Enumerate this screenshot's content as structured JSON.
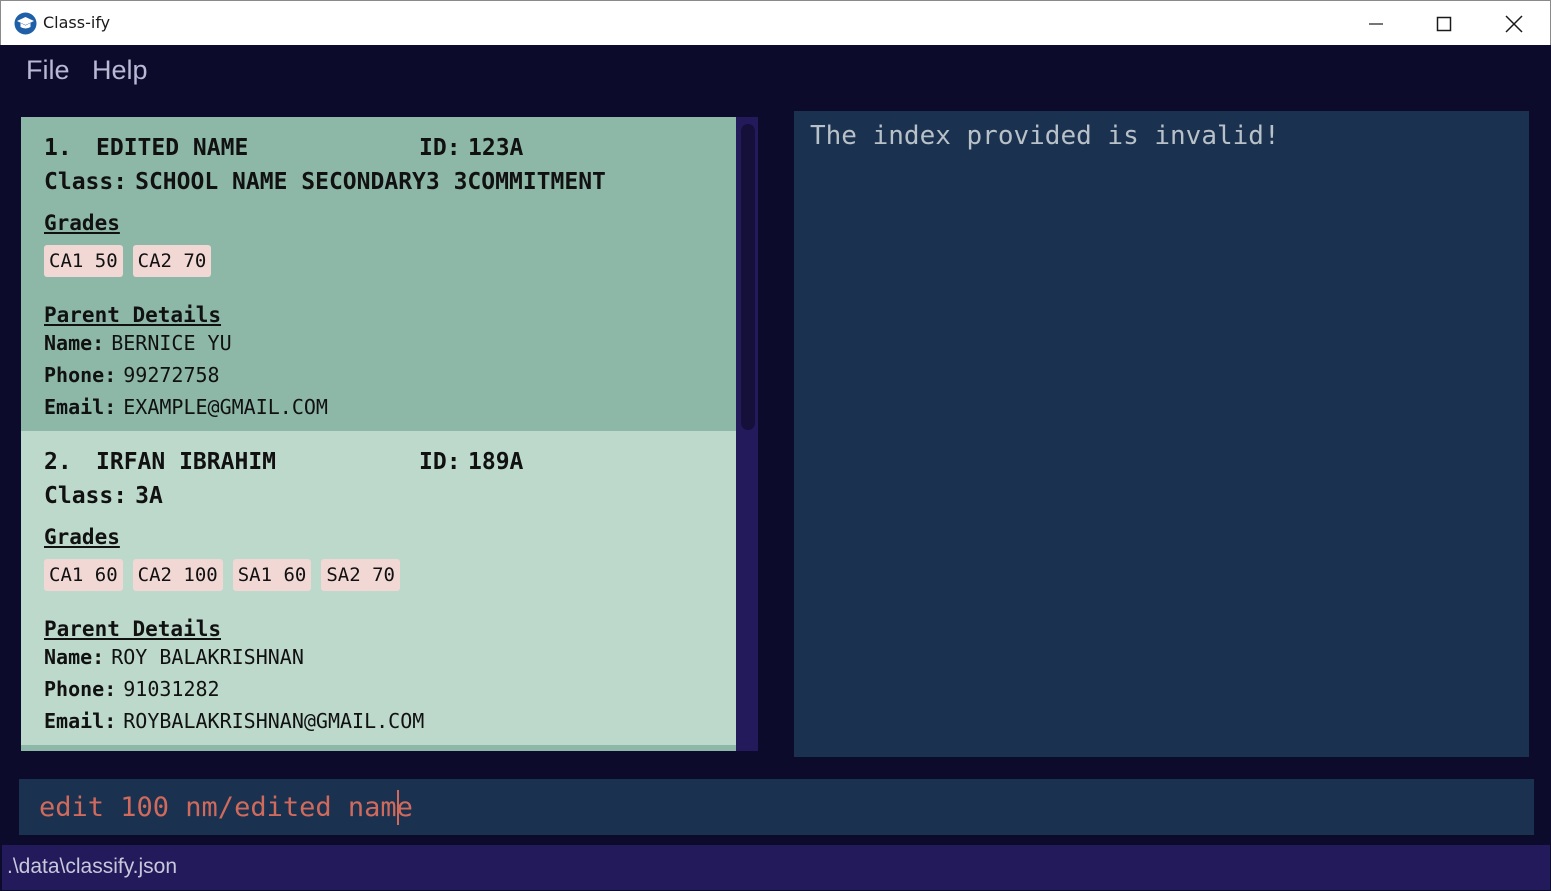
{
  "window": {
    "title": "Class-ify",
    "icon": "graduation-cap-icon"
  },
  "menu": {
    "file": "File",
    "help": "Help"
  },
  "students": [
    {
      "index": "1.",
      "name": "EDITED NAME",
      "id_label": "ID:",
      "id": "123A",
      "class_label": "Class:",
      "class": "SCHOOL NAME SECONDARY3 3COMMITMENT",
      "grades_title": "Grades",
      "grades": [
        "CA1 50",
        "CA2 70"
      ],
      "parent_title": "Parent Details",
      "parent_name_label": "Name:",
      "parent_name": "BERNICE YU",
      "phone_label": "Phone:",
      "phone": "99272758",
      "email_label": "Email:",
      "email": "EXAMPLE@GMAIL.COM"
    },
    {
      "index": "2.",
      "name": "IRFAN IBRAHIM",
      "id_label": "ID:",
      "id": "189A",
      "class_label": "Class:",
      "class": "3A",
      "grades_title": "Grades",
      "grades": [
        "CA1 60",
        "CA2 100",
        "SA1 60",
        "SA2 70"
      ],
      "parent_title": "Parent Details",
      "parent_name_label": "Name:",
      "parent_name": "ROY BALAKRISHNAN",
      "phone_label": "Phone:",
      "phone": "91031282",
      "email_label": "Email:",
      "email": "ROYBALAKRISHNAN@GMAIL.COM"
    }
  ],
  "result": {
    "message": "The index provided is invalid!"
  },
  "command": {
    "value": "edit 100 nm/edited name"
  },
  "status": {
    "file_path": ".\\data\\classify.json"
  },
  "colors": {
    "background": "#0d0b2b",
    "selected_card": "#8db8a8",
    "card": "#bcd9cc",
    "grade_tag": "#f1d8d5",
    "result_panel": "#1a3150",
    "command_text": "#d06a5c",
    "status_bar": "#221a5a"
  }
}
